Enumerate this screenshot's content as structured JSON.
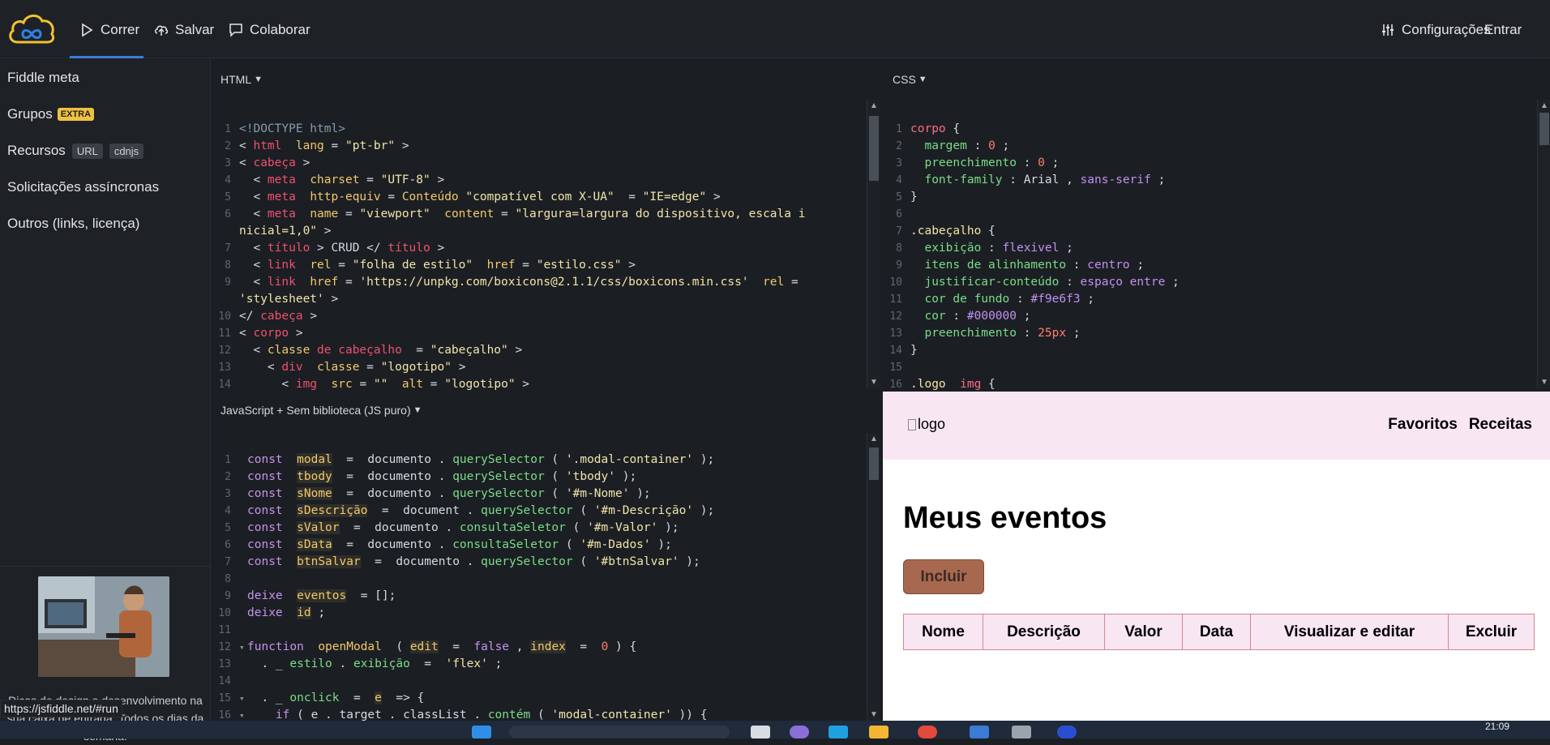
{
  "topbar": {
    "run_label": "Correr",
    "save_label": "Salvar",
    "collab_label": "Colaborar",
    "settings_label": "Configurações",
    "login_label": "Entrar"
  },
  "sidebar": {
    "items": [
      {
        "label": "Fiddle meta"
      },
      {
        "label": "Grupos",
        "badge": "EXTRA"
      },
      {
        "label": "Recursos",
        "tags": [
          "URL",
          "cdnjs"
        ]
      },
      {
        "label": "Solicitações assíncronas"
      },
      {
        "label": "Outros (links, licença)"
      }
    ],
    "ad_text": "Dicas de design e desenvolvimento na sua caixa de entrada. Todos os dias da semana."
  },
  "status_url": "https://jsfiddle.net/#run",
  "panels": {
    "html_label": "HTML",
    "css_label": "CSS",
    "js_label": "JavaScript + Sem biblioteca (JS puro)"
  },
  "preview": {
    "logo_alt": "logo",
    "nav": [
      "Favoritos",
      "Receitas"
    ],
    "title": "Meus eventos",
    "button": "Incluir",
    "columns": [
      "Nome",
      "Descrição",
      "Valor",
      "Data",
      "Visualizar e editar",
      "Excluir"
    ]
  },
  "taskbar": {
    "time": "21:09"
  },
  "colors": {
    "accent": "#3d7dd8",
    "preview_header": "#f9e6f3",
    "include_button": "#a8684f"
  }
}
